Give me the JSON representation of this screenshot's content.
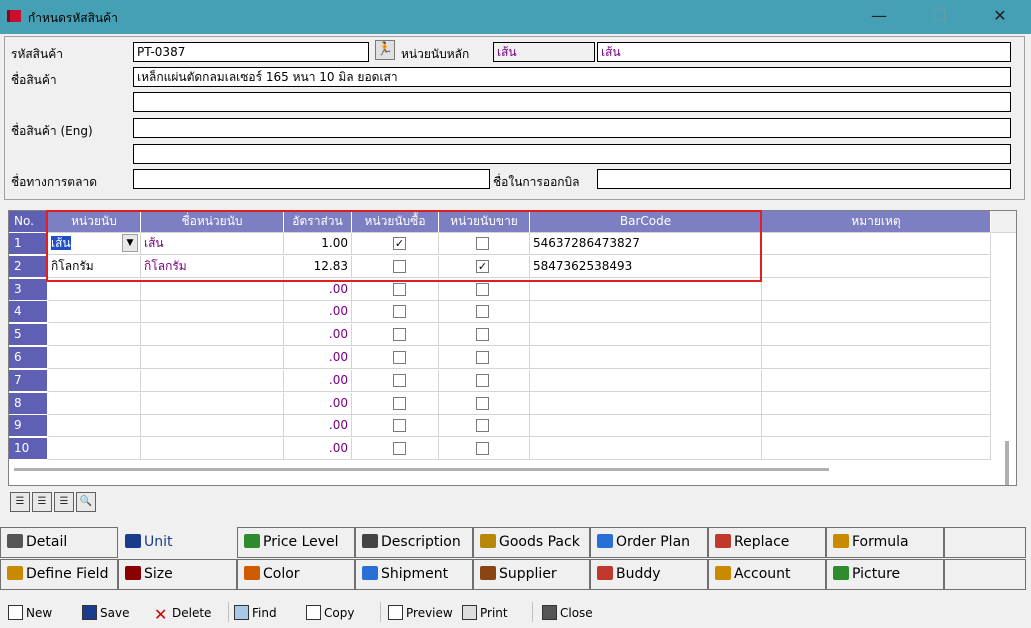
{
  "window": {
    "title": "กำหนดรหัสสินค้า",
    "min": "—",
    "max": "☐",
    "close": "✕"
  },
  "form": {
    "code_label": "รหัสสินค้า",
    "code_value": "PT-0387",
    "unit_main_label": "หน่วยนับหลัก",
    "unit_main_value1": "เส้น",
    "unit_main_value2": "เส้น",
    "name_label": "ชื่อสินค้า",
    "name_value": "เหล็กแผ่นตัดกลมเลเซอร์ 165 หนา 10 มิล ยอดเสา",
    "name_value2": "",
    "name_eng_label": "ชื่อสินค้า (Eng)",
    "name_eng_value": "",
    "name_eng_value2": "",
    "market_label": "ชื่อทางการตลาด",
    "market_value": "",
    "bill_label": "ชื่อในการออกบิล",
    "bill_value": ""
  },
  "grid": {
    "headers": [
      "No.",
      "หน่วยนับ",
      "ชื่อหน่วยนับ",
      "อัตราส่วน",
      "หน่วยนับซื้อ",
      "หน่วยนับขาย",
      "BarCode",
      "หมายเหตุ"
    ],
    "rows": [
      {
        "no": "1",
        "unit": "เส้น",
        "name": "เส้น",
        "ratio": "1.00",
        "buy": true,
        "sell": false,
        "barcode": "54637286473827",
        "note": ""
      },
      {
        "no": "2",
        "unit": "กิโลกรัม",
        "name": "กิโลกรัม",
        "ratio": "12.83",
        "buy": false,
        "sell": true,
        "barcode": "5847362538493",
        "note": ""
      },
      {
        "no": "3",
        "unit": "",
        "name": "",
        "ratio": ".00",
        "buy": false,
        "sell": false,
        "barcode": "",
        "note": ""
      },
      {
        "no": "4",
        "unit": "",
        "name": "",
        "ratio": ".00",
        "buy": false,
        "sell": false,
        "barcode": "",
        "note": ""
      },
      {
        "no": "5",
        "unit": "",
        "name": "",
        "ratio": ".00",
        "buy": false,
        "sell": false,
        "barcode": "",
        "note": ""
      },
      {
        "no": "6",
        "unit": "",
        "name": "",
        "ratio": ".00",
        "buy": false,
        "sell": false,
        "barcode": "",
        "note": ""
      },
      {
        "no": "7",
        "unit": "",
        "name": "",
        "ratio": ".00",
        "buy": false,
        "sell": false,
        "barcode": "",
        "note": ""
      },
      {
        "no": "8",
        "unit": "",
        "name": "",
        "ratio": ".00",
        "buy": false,
        "sell": false,
        "barcode": "",
        "note": ""
      },
      {
        "no": "9",
        "unit": "",
        "name": "",
        "ratio": ".00",
        "buy": false,
        "sell": false,
        "barcode": "",
        "note": ""
      },
      {
        "no": "10",
        "unit": "",
        "name": "",
        "ratio": ".00",
        "buy": false,
        "sell": false,
        "barcode": "",
        "note": ""
      }
    ]
  },
  "tabs_row1": [
    {
      "label": "Detail",
      "icon": "detail-icon",
      "color": "#555555"
    },
    {
      "label": "Unit",
      "icon": "unit-icon",
      "color": "#1a3c8c"
    },
    {
      "label": "Price Level",
      "icon": "price-level-icon",
      "color": "#2e8b2e"
    },
    {
      "label": "Description",
      "icon": "description-icon",
      "color": "#444444"
    },
    {
      "label": "Goods Pack",
      "icon": "goods-pack-icon",
      "color": "#b8860b"
    },
    {
      "label": "Order Plan",
      "icon": "order-plan-icon",
      "color": "#2a6fd6"
    },
    {
      "label": "Replace",
      "icon": "replace-icon",
      "color": "#c0392b"
    },
    {
      "label": "Formula",
      "icon": "formula-icon",
      "color": "#c98a00"
    }
  ],
  "tabs_row2": [
    {
      "label": "Define Field",
      "icon": "define-field-icon",
      "color": "#c98a00"
    },
    {
      "label": "Size",
      "icon": "size-icon",
      "color": "#8b0000"
    },
    {
      "label": "Color",
      "icon": "color-icon",
      "color": "#d05a00"
    },
    {
      "label": "Shipment",
      "icon": "shipment-icon",
      "color": "#2a6fd6"
    },
    {
      "label": "Supplier",
      "icon": "supplier-icon",
      "color": "#8b4513"
    },
    {
      "label": "Buddy",
      "icon": "buddy-icon",
      "color": "#c0392b"
    },
    {
      "label": "Account",
      "icon": "account-icon",
      "color": "#c98a00"
    },
    {
      "label": "Picture",
      "icon": "picture-icon",
      "color": "#2e8b2e"
    }
  ],
  "toolbar": {
    "new": "New",
    "save": "Save",
    "delete": "Delete",
    "find": "Find",
    "copy": "Copy",
    "preview": "Preview",
    "print": "Print",
    "close": "Close"
  }
}
